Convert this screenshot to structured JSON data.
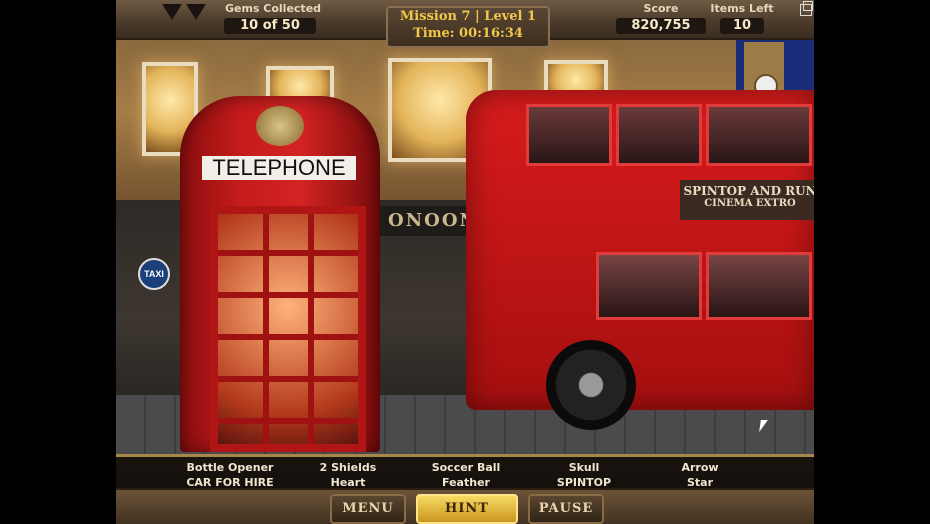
{
  "hud": {
    "gems_label": "Gems Collected",
    "gems_value": "10 of 50",
    "mission_title": "Mission 7 | Level 1",
    "time_text": "Time: 00:16:34",
    "score_label": "Score",
    "score_value": "820,755",
    "items_left_label": "Items Left",
    "items_left_value": "10"
  },
  "scene": {
    "phone_sign": "TELEPHONE",
    "shop_sign": "ONOON",
    "taxi_sign": "TAXI",
    "bus_ad_line1": "SPINTOP AND RUN",
    "bus_ad_line2": "CINEMA EXTRO"
  },
  "items_to_find": [
    {
      "top": "Bottle Opener",
      "bottom": "CAR FOR HIRE"
    },
    {
      "top": "2 Shields",
      "bottom": "Heart"
    },
    {
      "top": "Soccer Ball",
      "bottom": "Feather"
    },
    {
      "top": "Skull",
      "bottom": "SPINTOP"
    },
    {
      "top": "Arrow",
      "bottom": "Star"
    }
  ],
  "buttons": {
    "menu": "MENU",
    "hint": "HINT",
    "pause": "PAUSE"
  },
  "colors": {
    "hint_gold": "#f6da63",
    "mission_text": "#f0c84a",
    "bus_red": "#d81c1c"
  }
}
